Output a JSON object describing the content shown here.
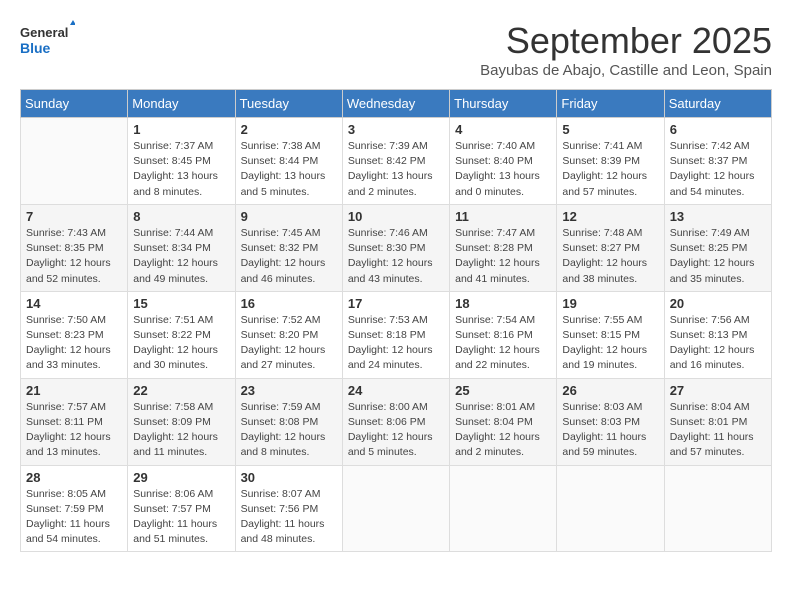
{
  "header": {
    "logo_general": "General",
    "logo_blue": "Blue",
    "month_title": "September 2025",
    "subtitle": "Bayubas de Abajo, Castille and Leon, Spain"
  },
  "weekdays": [
    "Sunday",
    "Monday",
    "Tuesday",
    "Wednesday",
    "Thursday",
    "Friday",
    "Saturday"
  ],
  "weeks": [
    [
      {
        "day": "",
        "info": ""
      },
      {
        "day": "1",
        "info": "Sunrise: 7:37 AM\nSunset: 8:45 PM\nDaylight: 13 hours\nand 8 minutes."
      },
      {
        "day": "2",
        "info": "Sunrise: 7:38 AM\nSunset: 8:44 PM\nDaylight: 13 hours\nand 5 minutes."
      },
      {
        "day": "3",
        "info": "Sunrise: 7:39 AM\nSunset: 8:42 PM\nDaylight: 13 hours\nand 2 minutes."
      },
      {
        "day": "4",
        "info": "Sunrise: 7:40 AM\nSunset: 8:40 PM\nDaylight: 13 hours\nand 0 minutes."
      },
      {
        "day": "5",
        "info": "Sunrise: 7:41 AM\nSunset: 8:39 PM\nDaylight: 12 hours\nand 57 minutes."
      },
      {
        "day": "6",
        "info": "Sunrise: 7:42 AM\nSunset: 8:37 PM\nDaylight: 12 hours\nand 54 minutes."
      }
    ],
    [
      {
        "day": "7",
        "info": "Sunrise: 7:43 AM\nSunset: 8:35 PM\nDaylight: 12 hours\nand 52 minutes."
      },
      {
        "day": "8",
        "info": "Sunrise: 7:44 AM\nSunset: 8:34 PM\nDaylight: 12 hours\nand 49 minutes."
      },
      {
        "day": "9",
        "info": "Sunrise: 7:45 AM\nSunset: 8:32 PM\nDaylight: 12 hours\nand 46 minutes."
      },
      {
        "day": "10",
        "info": "Sunrise: 7:46 AM\nSunset: 8:30 PM\nDaylight: 12 hours\nand 43 minutes."
      },
      {
        "day": "11",
        "info": "Sunrise: 7:47 AM\nSunset: 8:28 PM\nDaylight: 12 hours\nand 41 minutes."
      },
      {
        "day": "12",
        "info": "Sunrise: 7:48 AM\nSunset: 8:27 PM\nDaylight: 12 hours\nand 38 minutes."
      },
      {
        "day": "13",
        "info": "Sunrise: 7:49 AM\nSunset: 8:25 PM\nDaylight: 12 hours\nand 35 minutes."
      }
    ],
    [
      {
        "day": "14",
        "info": "Sunrise: 7:50 AM\nSunset: 8:23 PM\nDaylight: 12 hours\nand 33 minutes."
      },
      {
        "day": "15",
        "info": "Sunrise: 7:51 AM\nSunset: 8:22 PM\nDaylight: 12 hours\nand 30 minutes."
      },
      {
        "day": "16",
        "info": "Sunrise: 7:52 AM\nSunset: 8:20 PM\nDaylight: 12 hours\nand 27 minutes."
      },
      {
        "day": "17",
        "info": "Sunrise: 7:53 AM\nSunset: 8:18 PM\nDaylight: 12 hours\nand 24 minutes."
      },
      {
        "day": "18",
        "info": "Sunrise: 7:54 AM\nSunset: 8:16 PM\nDaylight: 12 hours\nand 22 minutes."
      },
      {
        "day": "19",
        "info": "Sunrise: 7:55 AM\nSunset: 8:15 PM\nDaylight: 12 hours\nand 19 minutes."
      },
      {
        "day": "20",
        "info": "Sunrise: 7:56 AM\nSunset: 8:13 PM\nDaylight: 12 hours\nand 16 minutes."
      }
    ],
    [
      {
        "day": "21",
        "info": "Sunrise: 7:57 AM\nSunset: 8:11 PM\nDaylight: 12 hours\nand 13 minutes."
      },
      {
        "day": "22",
        "info": "Sunrise: 7:58 AM\nSunset: 8:09 PM\nDaylight: 12 hours\nand 11 minutes."
      },
      {
        "day": "23",
        "info": "Sunrise: 7:59 AM\nSunset: 8:08 PM\nDaylight: 12 hours\nand 8 minutes."
      },
      {
        "day": "24",
        "info": "Sunrise: 8:00 AM\nSunset: 8:06 PM\nDaylight: 12 hours\nand 5 minutes."
      },
      {
        "day": "25",
        "info": "Sunrise: 8:01 AM\nSunset: 8:04 PM\nDaylight: 12 hours\nand 2 minutes."
      },
      {
        "day": "26",
        "info": "Sunrise: 8:03 AM\nSunset: 8:03 PM\nDaylight: 11 hours\nand 59 minutes."
      },
      {
        "day": "27",
        "info": "Sunrise: 8:04 AM\nSunset: 8:01 PM\nDaylight: 11 hours\nand 57 minutes."
      }
    ],
    [
      {
        "day": "28",
        "info": "Sunrise: 8:05 AM\nSunset: 7:59 PM\nDaylight: 11 hours\nand 54 minutes."
      },
      {
        "day": "29",
        "info": "Sunrise: 8:06 AM\nSunset: 7:57 PM\nDaylight: 11 hours\nand 51 minutes."
      },
      {
        "day": "30",
        "info": "Sunrise: 8:07 AM\nSunset: 7:56 PM\nDaylight: 11 hours\nand 48 minutes."
      },
      {
        "day": "",
        "info": ""
      },
      {
        "day": "",
        "info": ""
      },
      {
        "day": "",
        "info": ""
      },
      {
        "day": "",
        "info": ""
      }
    ]
  ]
}
